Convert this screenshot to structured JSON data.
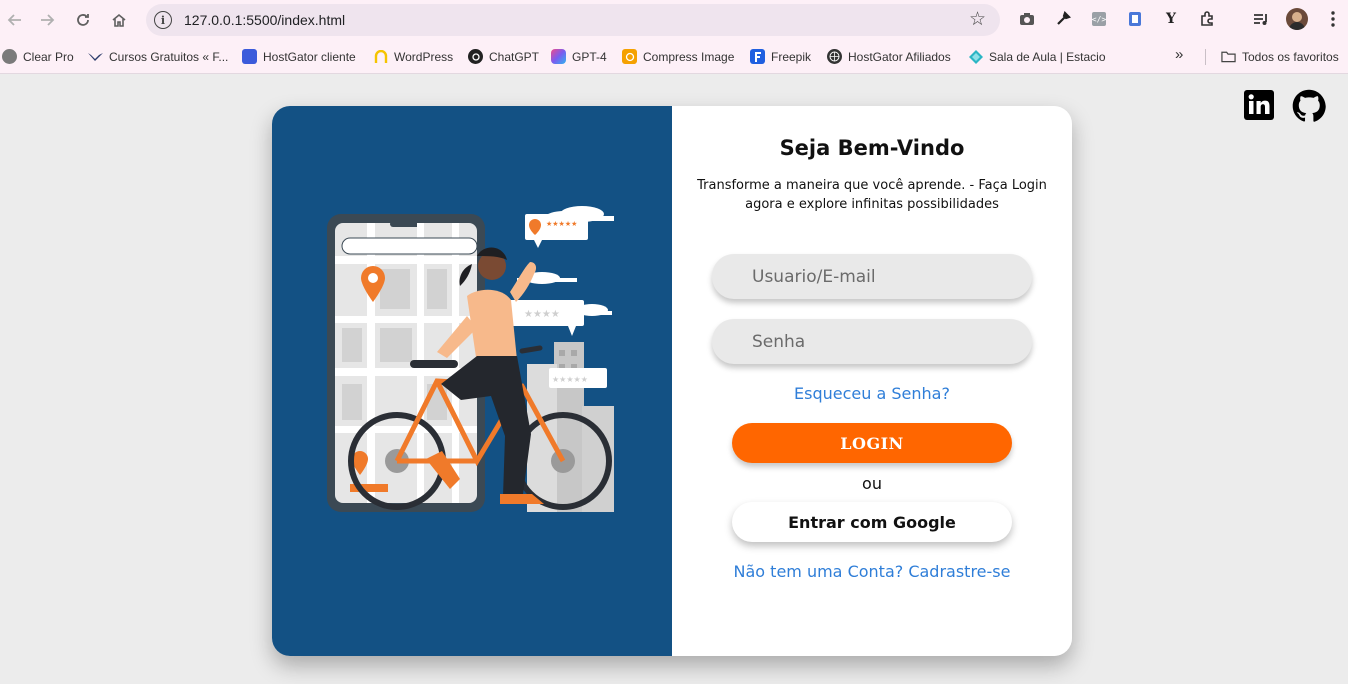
{
  "browser": {
    "url": "127.0.0.1:5500/index.html",
    "bookmarks": [
      {
        "label": "Clear Pro",
        "icon": "clear-pro-icon",
        "color": "#7a7a7a"
      },
      {
        "label": "Cursos Gratuitos « F...",
        "icon": "cursos-icon",
        "color": "#2a3a6a"
      },
      {
        "label": "HostGator cliente",
        "icon": "hostgator-icon",
        "color": "#3b5bdb"
      },
      {
        "label": "WordPress",
        "icon": "wordpress-icon",
        "color": "#f5c400"
      },
      {
        "label": "ChatGPT",
        "icon": "chatgpt-icon",
        "color": "#222222"
      },
      {
        "label": "GPT-4",
        "icon": "gpt4-icon",
        "color": "#a05cf0"
      },
      {
        "label": "Compress Image",
        "icon": "compress-icon",
        "color": "#f5a100"
      },
      {
        "label": "Freepik",
        "icon": "freepik-icon",
        "color": "#1f5fe0"
      },
      {
        "label": "HostGator Afiliados",
        "icon": "globe-icon",
        "color": "#333333"
      },
      {
        "label": "Sala de Aula | Estacio",
        "icon": "estacio-icon",
        "color": "#2bb5c4"
      }
    ],
    "more": "»",
    "all_favorites": "Todos os favoritos"
  },
  "login": {
    "title": "Seja Bem-Vindo",
    "subtitle": "Transforme a maneira que você aprende. - Faça Login agora e explore infinitas possibilidades",
    "username_placeholder": "Usuario/E-mail",
    "password_placeholder": "Senha",
    "forgot": "Esqueceu a Senha?",
    "login_button": "LOGIN",
    "or": "ou",
    "google_button": "Entrar com Google",
    "signup": "Não tem uma Conta? Cadrastre-se"
  },
  "colors": {
    "panel": "#135184",
    "accent": "#ff6600",
    "link": "#2f7ed8"
  }
}
